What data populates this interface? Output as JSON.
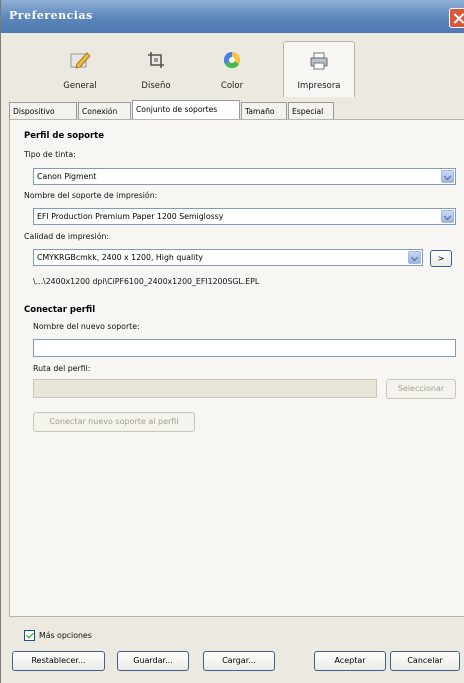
{
  "window": {
    "title": "Preferencias"
  },
  "toolbar": {
    "items": [
      {
        "label": "General",
        "icon": "pencil-icon"
      },
      {
        "label": "Diseño",
        "icon": "crop-icon"
      },
      {
        "label": "Color",
        "icon": "color-wheel-icon"
      },
      {
        "label": "Impresora",
        "icon": "printer-icon"
      }
    ],
    "active": "Impresora"
  },
  "tabs": {
    "items": [
      "Dispositivo",
      "Conexión",
      "Conjunto de soportes",
      "Tamaño",
      "Especial"
    ],
    "active": "Conjunto de soportes"
  },
  "media_profile": {
    "heading": "Perfil de soporte",
    "ink_type": {
      "label": "Tipo de tinta:",
      "value": "Canon Pigment"
    },
    "media_name": {
      "label": "Nombre del soporte de impresión:",
      "value": "EFI Production Premium Paper 1200 Semiglossy"
    },
    "print_quality": {
      "label": "Calidad de impresión:",
      "value": "CMYKRGBcmkk, 2400 x 1200, High quality",
      "more_button": ">"
    },
    "profile_path": "\\...\\2400x1200 dpi\\CiPF6100_2400x1200_EFI1200SGL.EPL"
  },
  "connect_profile": {
    "heading": "Conectar perfil",
    "new_media_name": {
      "label": "Nombre del nuevo soporte:",
      "value": ""
    },
    "profile_path": {
      "label": "Ruta del perfil:",
      "value": "",
      "select_button": "Seleccionar"
    },
    "connect_button": "Conectar nuevo soporte al perfil"
  },
  "footer": {
    "more_options": {
      "label": "Más opciones",
      "checked": true
    },
    "buttons": {
      "reset": "Restablecer...",
      "save": "Guardar...",
      "load": "Cargar...",
      "accept": "Aceptar",
      "cancel": "Cancelar"
    }
  }
}
